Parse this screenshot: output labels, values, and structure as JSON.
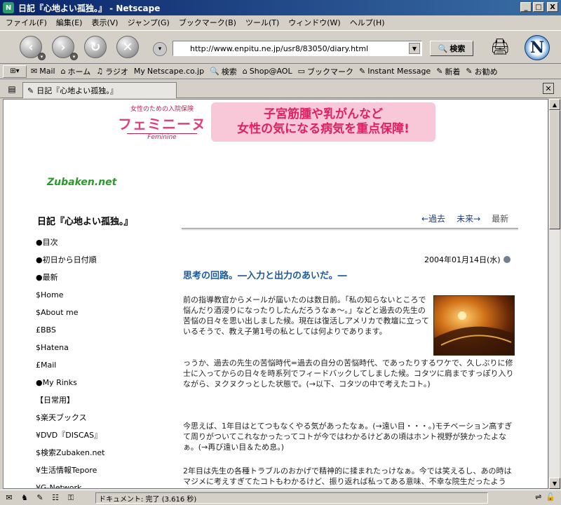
{
  "window": {
    "title": "日記『心地よい孤独。』 - Netscape",
    "app_icon": "N",
    "minimize": "_",
    "maximize": "□",
    "close": "X"
  },
  "menu": [
    "ファイル(F)",
    "編集(E)",
    "表示(V)",
    "ジャンプ(G)",
    "ブックマーク(B)",
    "ツール(T)",
    "ウィンドウ(W)",
    "ヘルプ(H)"
  ],
  "nav": {
    "back": "‹",
    "forward": "›",
    "reload": "↻",
    "stop": "✕",
    "url": "http://www.enpitu.ne.jp/usr8/83050/diary.html",
    "search_label": "検索",
    "logo": "N"
  },
  "personal_toolbar": [
    {
      "icon": "✉",
      "label": "Mail"
    },
    {
      "icon": "⌂",
      "label": "ホーム"
    },
    {
      "icon": "♫",
      "label": "ラジオ"
    },
    {
      "icon": "My",
      "label": "Netscape.co.jp"
    },
    {
      "icon": "🔍",
      "label": "検索"
    },
    {
      "icon": "⌂",
      "label": "Shop@AOL"
    },
    {
      "icon": "▭",
      "label": "ブックマーク"
    },
    {
      "icon": "✎",
      "label": "Instant Message"
    },
    {
      "icon": "✎",
      "label": "新着"
    },
    {
      "icon": "✎",
      "label": "お勧め"
    }
  ],
  "tab": {
    "title": "日記『心地よい孤独。』",
    "close": "✕"
  },
  "ad": {
    "tag": "女性のための入院保険",
    "brand": "フェミニーヌ",
    "brand_en": "Feminine",
    "line1": "子宮筋腫や乳がんなど",
    "line2": "女性の気になる病気を重点保障!"
  },
  "page": {
    "logo": "Zubaken.net",
    "site_title": "日記『心地よい孤独。』",
    "menu_items": [
      "●目次",
      "●初日から日付順",
      "●最新",
      "$Home",
      "$About me",
      "£BBS",
      "$Hatena",
      "£Mail",
      "●My Rinks",
      "【日常用】",
      "$楽天ブックス",
      "¥DVD『DISCAS』",
      "$検索Zubaken.net",
      "¥生活情報Tepore",
      "¥G-Network"
    ],
    "nav_prev": "←過去",
    "nav_next": "未来→",
    "nav_latest": "最新",
    "entry_date": "2004年01月14日(水)",
    "entry_title": "思考の回路。―入力と出力のあいだ。―",
    "p1": "前の指導教官からメールが届いたのは数日前。「私の知らないところで悩んだり酒浸りになったりしたんだろうなぁ〜。」などと過去の先生の苦悩の日々を思い出しました候。現在は復活しアメリカで教壇に立っているそうで、教え子第1号の私としては何よりであります。",
    "p2": "っうか、過去の先生の苦悩時代=過去の自分の苦悩時代、であったりするワケで、久しぶりに修士に入ってからの日々を時系列でフィードバックしてしました候。コタツに肩まですっぽり入りながら、ヌクヌクっとした状態で。(→以下、コタツの中で考えたコト。)",
    "p3": "今思えば、1年目はとてつもなくやる気があったなぁ。(→遠い目・・・。)モチベーション高すぎて周りがついてこれなかったってコトが今ではわかるけどあの頃はホント視野が狭かったよなぁ。(→再び遠い目＆ため息。)",
    "p4": "2年目は先生の各種トラブルのおかげで精神的に揉まれたっけなぁ。今では笑えるし、あの時はマジメに考えすぎてたコトもわかるけど、振り返れば私ってある意味、不幸な院生だったよう"
  },
  "status": {
    "text": "ドキュメント: 完了 (3.616 秒)"
  }
}
